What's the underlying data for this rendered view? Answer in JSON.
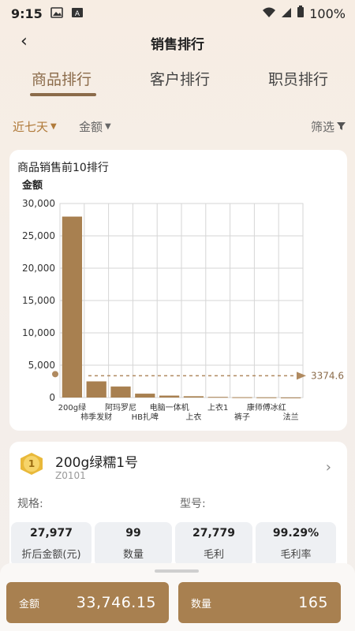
{
  "status_bar": {
    "time": "9:15",
    "battery": "100%"
  },
  "nav": {
    "back": "‹",
    "title": "销售排行"
  },
  "tabs": [
    {
      "label": "商品排行",
      "active": true
    },
    {
      "label": "客户排行",
      "active": false
    },
    {
      "label": "职员排行",
      "active": false
    }
  ],
  "filters": {
    "period": "近七天",
    "metric": "金额",
    "filter_label": "筛选"
  },
  "colors": {
    "accent": "#8b6b4a",
    "bar": "#a88050",
    "button": "#a88050"
  },
  "chart_data": {
    "type": "bar",
    "title": "商品销售前10排行",
    "ylabel": "金额",
    "ylim": [
      0,
      30000
    ],
    "yticks": [
      "0",
      "5,000",
      "10,000",
      "15,000",
      "20,000",
      "25,000",
      "30,000"
    ],
    "categories": [
      "200g绿",
      "柿季发财",
      "阿玛罗尼",
      "HB扎啤",
      "电脑一体机",
      "上衣",
      "上衣1",
      "裤子",
      "康师傅冰红",
      "法兰"
    ],
    "values": [
      27977,
      2500,
      1700,
      600,
      300,
      200,
      100,
      50,
      30,
      10
    ],
    "average_line": {
      "value": 3374.6,
      "label": "3374.6"
    }
  },
  "product": {
    "rank": "1",
    "name": "200g绿糯1号",
    "code": "Z0101",
    "spec_label": "规格:",
    "model_label": "型号:",
    "stats": [
      {
        "value": "27,977",
        "label": "折后金额(元)"
      },
      {
        "value": "99",
        "label": "数量"
      },
      {
        "value": "27,779",
        "label": "毛利"
      },
      {
        "value": "99.29%",
        "label": "毛利率"
      }
    ]
  },
  "bottom": {
    "amount_label": "金额",
    "amount_value": "33,746.15",
    "qty_label": "数量",
    "qty_value": "165"
  }
}
